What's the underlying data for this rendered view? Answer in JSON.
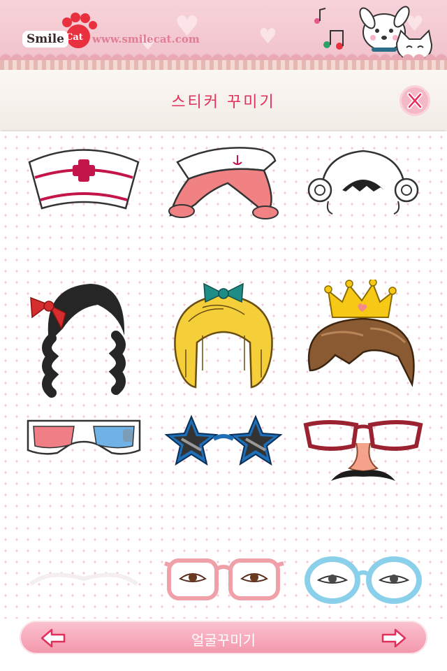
{
  "header": {
    "logo_word": "Smile",
    "logo_badge": "Cat",
    "url": "www.smilecat.com"
  },
  "titlebar": {
    "title": "스티커 꾸미기"
  },
  "stickers": [
    {
      "name": "nurse-cap"
    },
    {
      "name": "sailor-hat-pigtails"
    },
    {
      "name": "curly-white-wig"
    },
    {
      "name": "black-braided-hair-bow"
    },
    {
      "name": "blonde-ringlet-hair"
    },
    {
      "name": "brown-hair-crown"
    },
    {
      "name": "3d-glasses"
    },
    {
      "name": "star-sunglasses"
    },
    {
      "name": "groucho-glasses"
    },
    {
      "name": "empty-slot"
    },
    {
      "name": "pink-glasses-eyes"
    },
    {
      "name": "blue-glasses-eyes"
    }
  ],
  "bottombar": {
    "label": "얼굴꾸미기"
  },
  "colors": {
    "accent": "#e0305b",
    "banner": "#f1c2cc",
    "bottom": "#f396ab"
  }
}
